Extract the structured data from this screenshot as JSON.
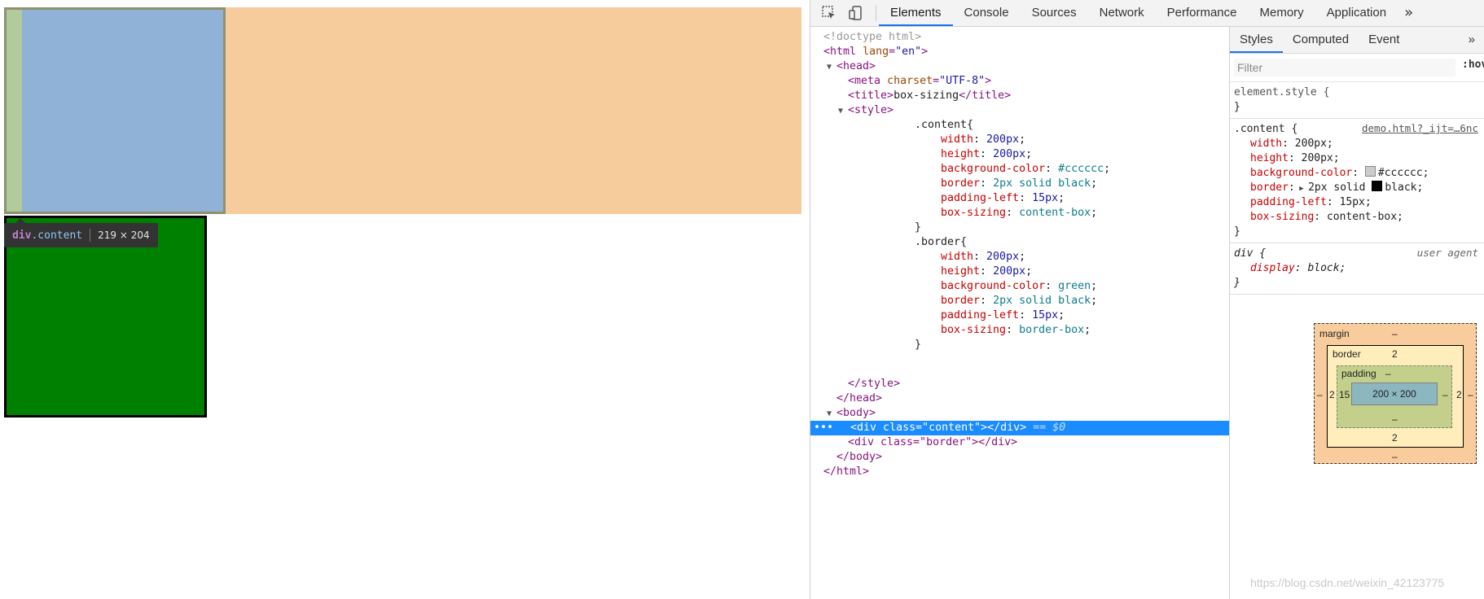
{
  "viewport": {
    "tooltip": {
      "tag": "div",
      "class_suffix": ".content",
      "size": "219 × 204"
    }
  },
  "devtools": {
    "tabs": [
      "Elements",
      "Console",
      "Sources",
      "Network",
      "Performance",
      "Memory",
      "Application"
    ],
    "more_tabs": "»",
    "tree": {
      "doctype": "<!doctype html>",
      "html_open_tag": "html",
      "html_lang_attr": "lang",
      "html_lang_val": "\"en\"",
      "head": "head",
      "meta_tag": "meta",
      "meta_attr": "charset",
      "meta_val": "\"UTF-8\"",
      "title_tag": "title",
      "title_text": "box-sizing",
      "style": "style",
      "content_selector": ".content{",
      "content_rules": [
        {
          "prop": "width",
          "val": "200px"
        },
        {
          "prop": "height",
          "val": "200px"
        },
        {
          "prop": "background-color",
          "val": "#cccccc"
        },
        {
          "prop": "border",
          "val": "2px solid black"
        },
        {
          "prop": "padding-left",
          "val": "15px"
        },
        {
          "prop": "box-sizing",
          "val": "content-box"
        }
      ],
      "close_brace": "}",
      "border_selector": ".border{",
      "border_rules": [
        {
          "prop": "width",
          "val": "200px"
        },
        {
          "prop": "height",
          "val": "200px"
        },
        {
          "prop": "background-color",
          "val": "green"
        },
        {
          "prop": "border",
          "val": "2px solid black"
        },
        {
          "prop": "padding-left",
          "val": "15px"
        },
        {
          "prop": "box-sizing",
          "val": "border-box"
        }
      ],
      "style_close": "/style",
      "head_close": "/head",
      "body": "body",
      "selected_div": "<div class=\"content\"></div>",
      "selected_eq": "== $0",
      "border_div": "<div class=\"border\"></div>",
      "body_close": "/body",
      "html_close": "/html"
    },
    "styles_pane": {
      "tabs": [
        "Styles",
        "Computed",
        "Event Listeners"
      ],
      "more": "»",
      "filter_placeholder": "Filter",
      "hov": ":hov",
      "element_style": "element.style {",
      "element_style_close": "}",
      "content_rule": {
        "selector": ".content {",
        "source": "demo.html?_ijt=…6nc",
        "decls": [
          {
            "prop": "width",
            "val": "200px;"
          },
          {
            "prop": "height",
            "val": "200px;"
          },
          {
            "prop": "background-color",
            "val": "#cccccc;"
          },
          {
            "prop": "border",
            "val": "2px solid ",
            "val2": "black;"
          },
          {
            "prop": "padding-left",
            "val": "15px;"
          },
          {
            "prop": "box-sizing",
            "val": "content-box;"
          }
        ],
        "close": "}",
        "swatch_gray": "#cccccc",
        "swatch_black": "#000000"
      },
      "ua_rule": {
        "selector": "div {",
        "source": "user agent",
        "decl_prop": "display",
        "decl_val": "block;",
        "close": "}"
      },
      "box_model": {
        "margin_label": "margin",
        "margin_top": "–",
        "margin_bottom": "–",
        "margin_left": "–",
        "margin_right": "–",
        "border_label": "border",
        "border_top": "2",
        "border_bottom": "2",
        "border_left": "2",
        "border_right": "2",
        "padding_label": "padding",
        "padding_top": "–",
        "padding_bottom": "–",
        "padding_left": "15",
        "padding_right": "–",
        "content_size": "200 × 200"
      }
    }
  },
  "watermark": "https://blog.csdn.net/weixin_42123775"
}
